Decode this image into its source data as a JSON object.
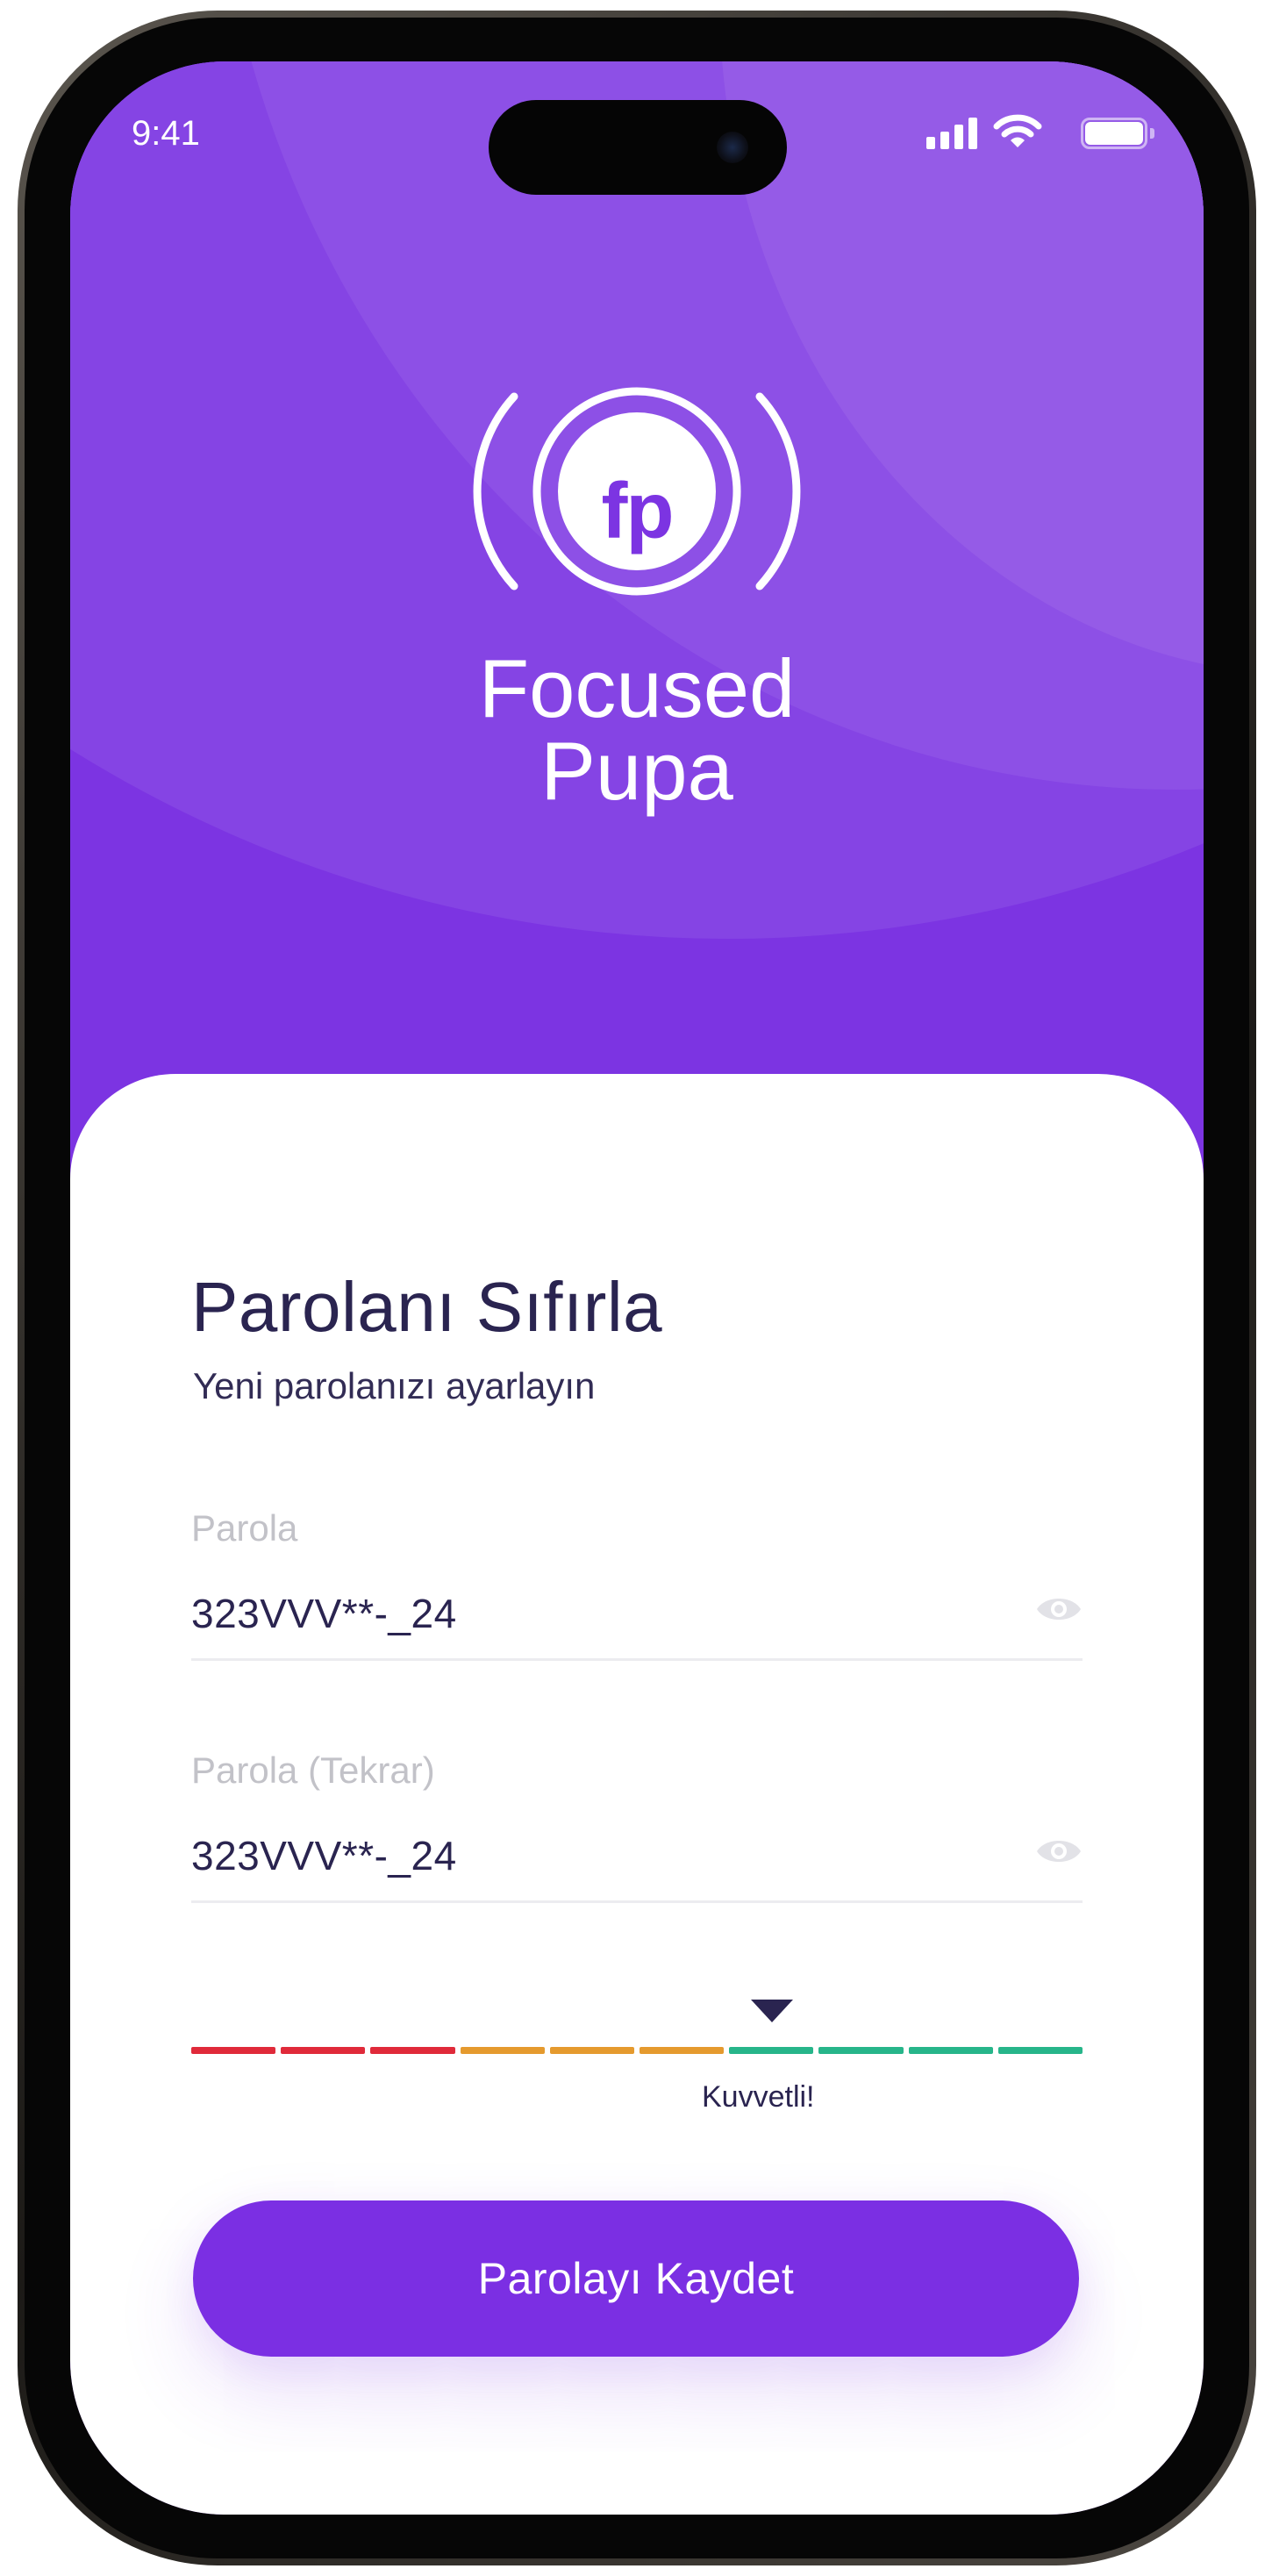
{
  "status_bar": {
    "time": "9:41",
    "icons": [
      "signal-icon",
      "wifi-icon",
      "battery-icon"
    ]
  },
  "brand": {
    "logo_text": "fp",
    "name_line1": "Focused",
    "name_line2": "Pupa"
  },
  "form": {
    "title": "Parolanı Sıfırla",
    "subtitle": "Yeni parolanızı ayarlayın",
    "password": {
      "label": "Parola",
      "value": "323VVV**-_24",
      "icon": "eye-icon"
    },
    "password_repeat": {
      "label": "Parola (Tekrar)",
      "value": "323VVV**-_24",
      "icon": "eye-icon"
    }
  },
  "strength_meter": {
    "label": "Kuvvetli!",
    "level_segments": 7,
    "total_segments": 10,
    "segment_colors": [
      "#e02a3a",
      "#e02a3a",
      "#e02a3a",
      "#e59a2e",
      "#e59a2e",
      "#e59a2e",
      "#27b58a",
      "#27b58a",
      "#27b58a",
      "#27b58a"
    ]
  },
  "actions": {
    "save_label": "Parolayı Kaydet"
  },
  "colors": {
    "primary": "#7b2fe3",
    "text_dark": "#2a2450",
    "label_gray": "#c2c2c8"
  }
}
